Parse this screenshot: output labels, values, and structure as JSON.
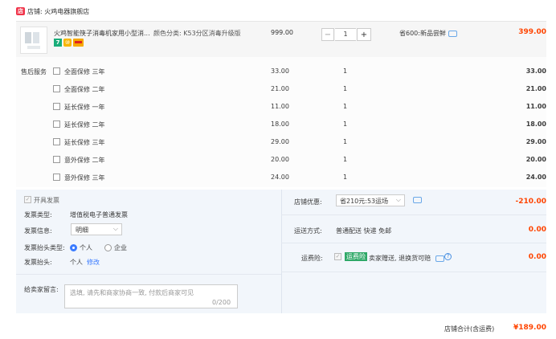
{
  "store": {
    "icon_text": "店",
    "label": "店铺: 火鸡电器旗舰店"
  },
  "product": {
    "title": "火鸡智能筷子消毒机家用小型消...",
    "spec": "颜色分类: K53分区消毒升级版",
    "badges": [
      "7",
      "⑩"
    ],
    "price": "999.00",
    "quantity": "1",
    "minus": "−",
    "plus": "+",
    "saving": "省600:新品尝鲜",
    "subtotal": "399.00"
  },
  "services": {
    "label": "售后服务",
    "items": [
      {
        "name": "全面保修 三年",
        "price": "33.00",
        "qty": "1",
        "total": "33.00"
      },
      {
        "name": "全面保修 二年",
        "price": "21.00",
        "qty": "1",
        "total": "21.00"
      },
      {
        "name": "延长保修 一年",
        "price": "11.00",
        "qty": "1",
        "total": "11.00"
      },
      {
        "name": "延长保修 二年",
        "price": "18.00",
        "qty": "1",
        "total": "18.00"
      },
      {
        "name": "延长保修 三年",
        "price": "29.00",
        "qty": "1",
        "total": "29.00"
      },
      {
        "name": "意外保修 二年",
        "price": "20.00",
        "qty": "1",
        "total": "20.00"
      },
      {
        "name": "意外保修 三年",
        "price": "24.00",
        "qty": "1",
        "total": "24.00"
      }
    ]
  },
  "invoice": {
    "check_label": "开具发票",
    "type_label": "发票类型:",
    "type_value": "增值税电子普通发票",
    "info_label": "发票信息:",
    "info_value": "明细",
    "header_type_label": "发票抬头类型:",
    "opt_personal": "个人",
    "opt_company": "企业",
    "header_label": "发票抬头:",
    "header_value": "个人",
    "modify": "修改"
  },
  "memo": {
    "label": "给卖家留言:",
    "placeholder": "选填, 请先和商家协商一致, 付款后商家可见",
    "counter": "0/200"
  },
  "discount": {
    "label": "店铺优惠:",
    "value": "省210元:53运场",
    "amount": "-210.00"
  },
  "shipping": {
    "label": "运送方式:",
    "value": "普通配送 快递 免邮",
    "amount": "0.00"
  },
  "insurance": {
    "label": "运费险:",
    "badge": "运费险",
    "text": "卖家赠送, 退换货可赔",
    "amount": "0.00"
  },
  "total": {
    "label": "店铺合计(含运费)",
    "value": "¥189.00"
  }
}
